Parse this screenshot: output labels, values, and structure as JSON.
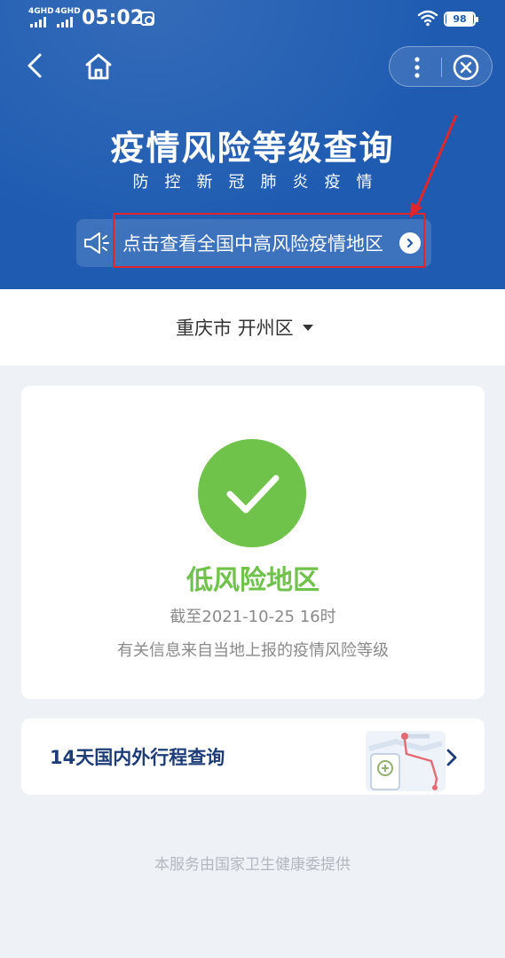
{
  "status_bar": {
    "signal_1": "4GHD",
    "signal_2": "4GHD",
    "time": "05:02",
    "battery": "98"
  },
  "header": {
    "title": "疫情风险等级查询",
    "subtitle": "防控新冠肺炎疫情",
    "notice_link": "点击查看全国中高风险疫情地区",
    "icons": [
      "back-arrow-icon",
      "home-icon",
      "more-dots-icon",
      "close-circle-icon",
      "speaker-icon",
      "chevron-right-icon"
    ]
  },
  "region": {
    "selected": "重庆市 开州区"
  },
  "result": {
    "level": "低风险地区",
    "as_of": "截至2021-10-25 16时",
    "source_note": "有关信息来自当地上报的疫情风险等级"
  },
  "trip_query": {
    "label": "14天国内外行程查询"
  },
  "footer": {
    "text": "本服务由国家卫生健康委提供"
  },
  "colors": {
    "header_blue": "#1e5bb1",
    "low_risk_green": "#6fc24a",
    "highlight_red": "#e0262b",
    "trip_text": "#1d3c78"
  }
}
